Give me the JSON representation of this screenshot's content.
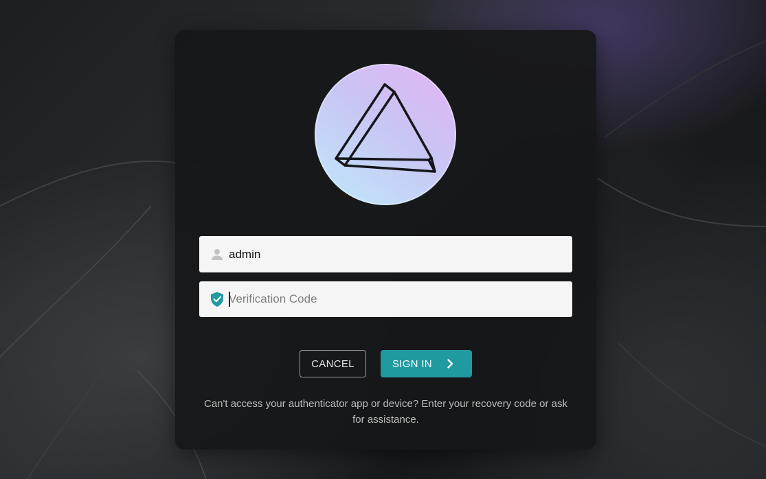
{
  "login": {
    "username_value": "admin",
    "code_placeholder": "Verification Code",
    "code_value": "",
    "cancel_label": "CANCEL",
    "signin_label": "SIGN IN",
    "help_text": "Can't access your authenticator app or device? Enter your recovery code or ask for assistance."
  },
  "icons": {
    "logo": "prism-logo",
    "username": "person-icon",
    "code": "shield-check-icon",
    "signin": "chevron-right-icon"
  },
  "colors": {
    "accent": "#1f9aa0",
    "field_bg": "#f5f5f5",
    "card_bg": "#161718"
  }
}
